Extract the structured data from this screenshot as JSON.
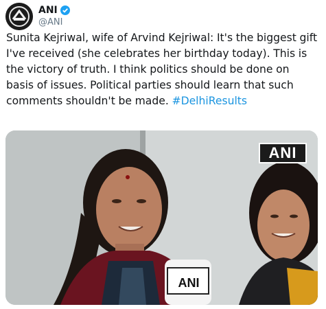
{
  "tweet": {
    "author": {
      "display_name": "ANI",
      "handle": "@ANI",
      "avatar_icon": "ani-logo-icon",
      "verified_icon": "verified-badge-icon",
      "verified_color": "#1da1f2"
    },
    "text_main": "Sunita Kejriwal, wife of Arvind Kejriwal: It's the biggest gift I've received (she celebrates her birthday today). This is the victory of truth. I think politics should be done on basis of issues. Political parties should learn that such comments shouldn't be made.",
    "hashtag": "#DelhiResults",
    "hashtag_color": "#1b95e0",
    "media": {
      "watermark": "ANI",
      "mic_logo": "ANI"
    }
  }
}
